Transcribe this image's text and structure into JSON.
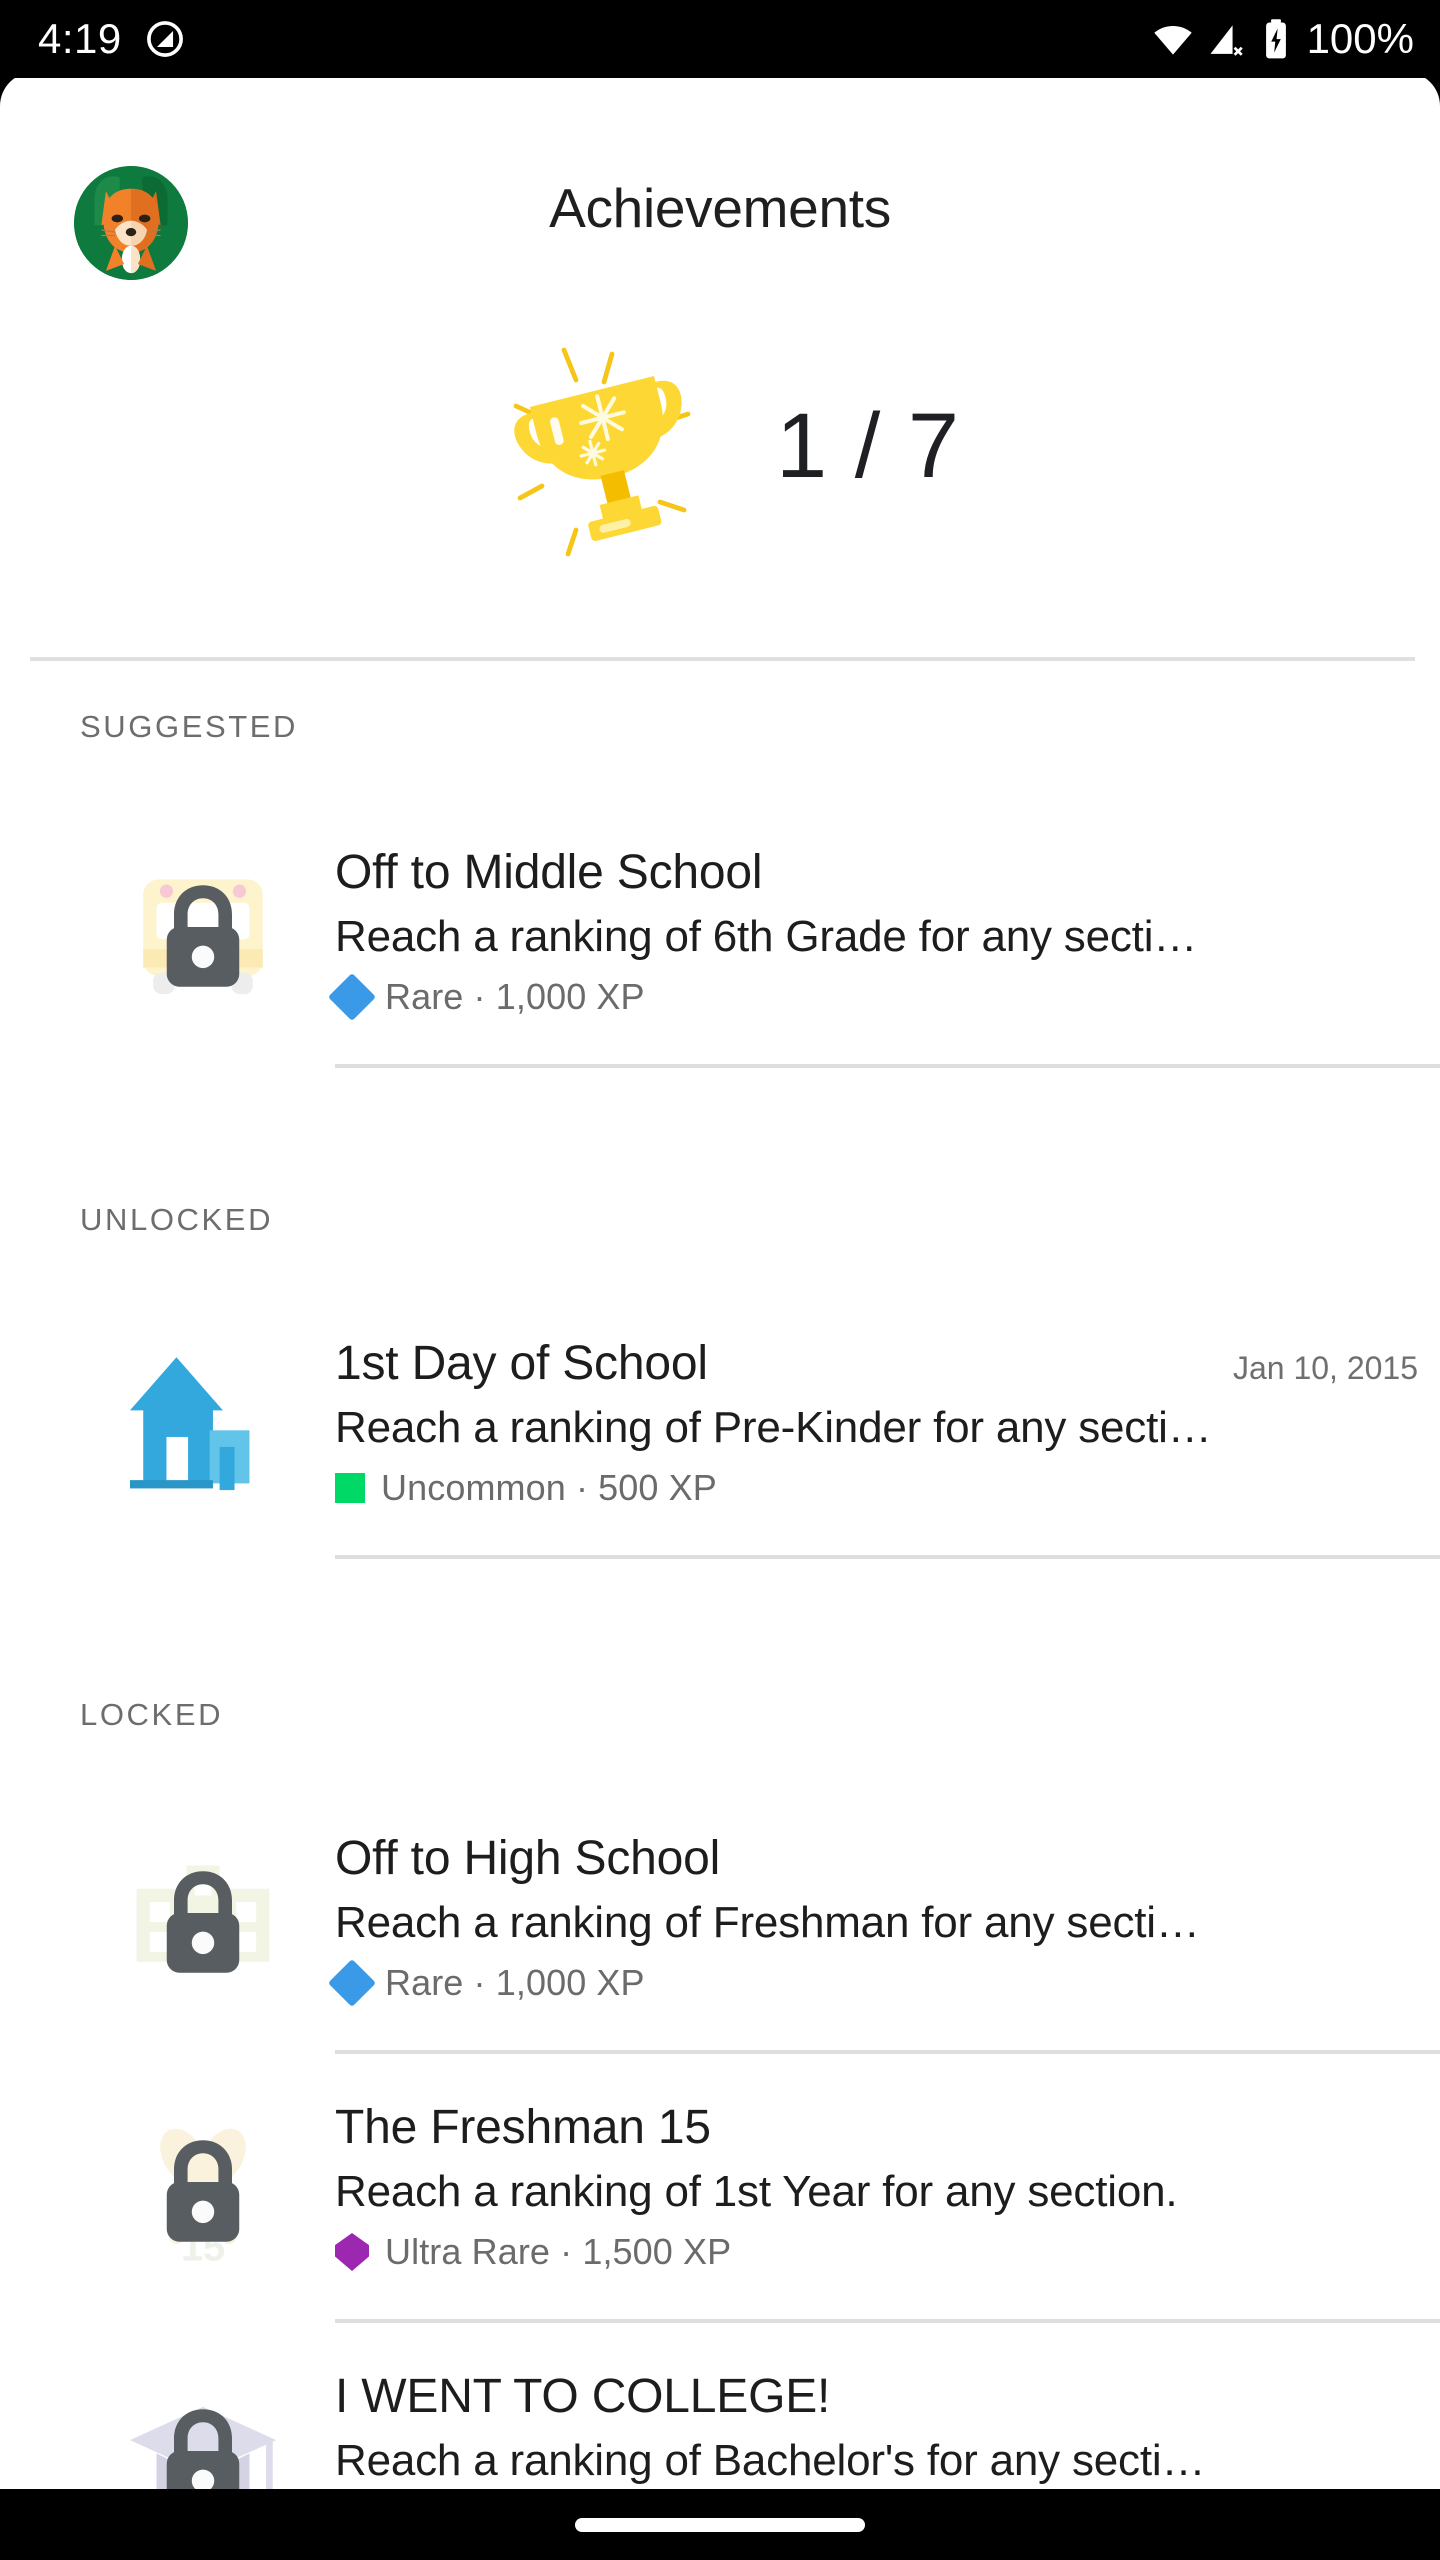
{
  "status_bar": {
    "time": "4:19",
    "do_not_disturb_icon": "do-not-disturb-icon",
    "wifi_icon": "wifi-icon",
    "cellular_off_icon": "cellular-no-signal-icon",
    "battery_icon": "battery-charging-icon",
    "battery_text": "100%"
  },
  "header": {
    "title": "Achievements",
    "avatar_icon": "fox-avatar",
    "trophy_icon": "trophy-icon",
    "trophy_count": "1 / 7"
  },
  "colors": {
    "rare": "#3b9ae8",
    "uncommon": "#00d966",
    "ultra_rare": "#9c27b0",
    "trophy": "#f6cf3a",
    "school_blue": "#32a8dd",
    "avatar_bg": "#0f7a3d",
    "lock": "#585d61",
    "divider": "#dedede"
  },
  "sections": [
    {
      "label": "SUGGESTED",
      "items": [
        {
          "title": "Off to Middle School",
          "description": "Reach a ranking of 6th Grade for any secti…",
          "rarity": "Rare",
          "xp": "1,000 XP",
          "meta": "Rare · 1,000 XP",
          "date": "",
          "locked": true,
          "marker_shape": "diamond",
          "marker_color": "#3b9ae8",
          "badge_icon": "school-bus-badge"
        }
      ]
    },
    {
      "label": "UNLOCKED",
      "items": [
        {
          "title": "1st Day of School",
          "description": "Reach a ranking of Pre-Kinder for any secti…",
          "rarity": "Uncommon",
          "xp": "500 XP",
          "meta": "Uncommon · 500 XP",
          "date": "Jan 10, 2015",
          "locked": false,
          "marker_shape": "square",
          "marker_color": "#00d966",
          "badge_icon": "school-house-badge"
        }
      ]
    },
    {
      "label": "LOCKED",
      "items": [
        {
          "title": "Off to High School",
          "description": "Reach a ranking of Freshman for any secti…",
          "rarity": "Rare",
          "xp": "1,000 XP",
          "meta": "Rare · 1,000 XP",
          "date": "",
          "locked": true,
          "marker_shape": "diamond",
          "marker_color": "#3b9ae8",
          "badge_icon": "high-school-building-badge"
        },
        {
          "title": "The Freshman 15",
          "description": "Reach a ranking of 1st Year for any section.",
          "rarity": "Ultra Rare",
          "xp": "1,500 XP",
          "meta": "Ultra Rare · 1,500 XP",
          "date": "",
          "locked": true,
          "marker_shape": "pentagon",
          "marker_color": "#9c27b0",
          "badge_icon": "crossed-utensils-badge"
        },
        {
          "title": "I WENT TO COLLEGE!",
          "description": "Reach a ranking of Bachelor's for any secti…",
          "rarity": "",
          "xp": "",
          "meta": "",
          "date": "",
          "locked": true,
          "marker_shape": "none",
          "marker_color": "",
          "badge_icon": "graduation-cap-badge"
        }
      ]
    }
  ],
  "nav_bar": {
    "home_pill": "home-gesture-pill"
  }
}
